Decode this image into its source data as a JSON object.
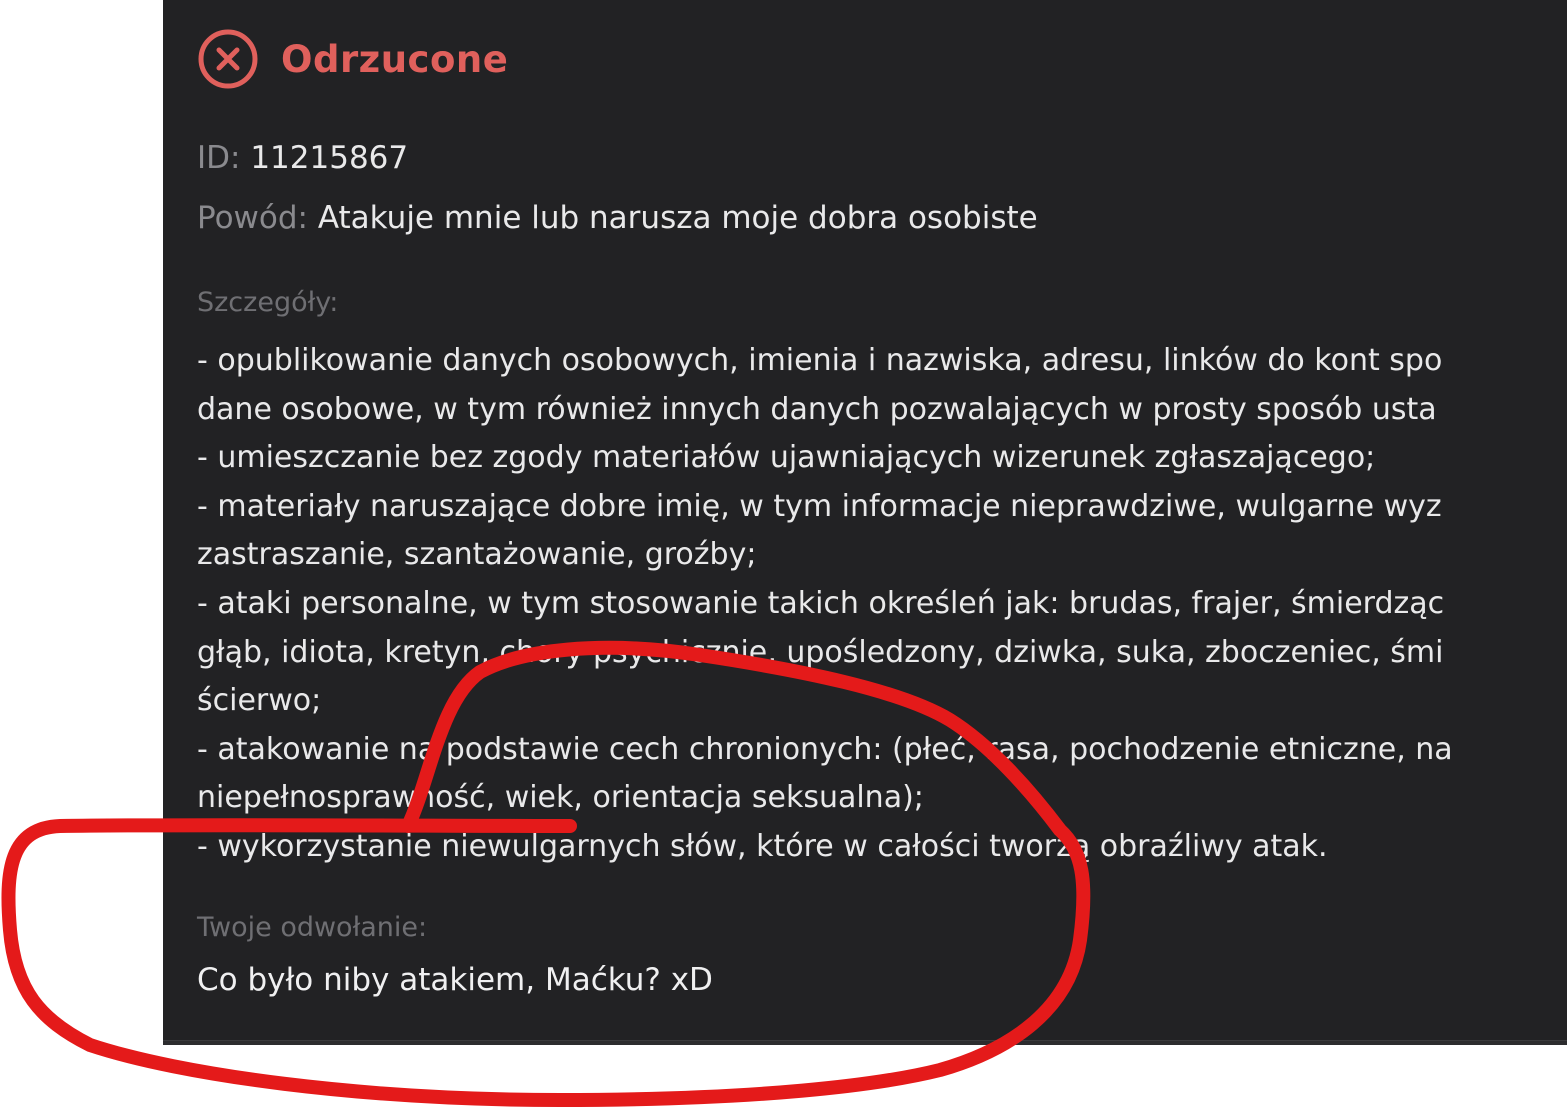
{
  "status": {
    "label": "Odrzucone",
    "icon": "x-circle-icon",
    "color": "#e0605c"
  },
  "report": {
    "id_label": "ID:",
    "id_value": "11215867",
    "reason_label": "Powód:",
    "reason_value": "Atakuje mnie lub narusza moje dobra osobiste"
  },
  "details": {
    "label": "Szczegóły:",
    "lines": [
      "- opublikowanie danych osobowych, imienia i nazwiska, adresu, linków do kont spo",
      "dane osobowe, w tym również innych danych pozwalających w prosty sposób usta",
      "- umieszczanie bez zgody materiałów ujawniających wizerunek zgłaszającego;",
      "- materiały naruszające dobre imię, w tym informacje nieprawdziwe, wulgarne wyz",
      "zastraszanie, szantażowanie, groźby;",
      "- ataki personalne, w tym stosowanie takich określeń jak: brudas, frajer, śmierdząc",
      "głąb, idiota, kretyn, chory psychicznie, upośledzony, dziwka, suka, zboczeniec, śmi",
      "ścierwo;",
      "- atakowanie na podstawie cech chronionych: (płeć, rasa, pochodzenie etniczne, na",
      "niepełnosprawność, wiek, orientacja seksualna);",
      "- wykorzystanie niewulgarnych słów, które w całości tworzą obraźliwy atak."
    ]
  },
  "appeal": {
    "label": "Twoje odwołanie:",
    "text": "Co było niby atakiem, Maćku? xD"
  },
  "colors": {
    "panel_bg": "#222224",
    "annotation": "#e41a1a"
  }
}
